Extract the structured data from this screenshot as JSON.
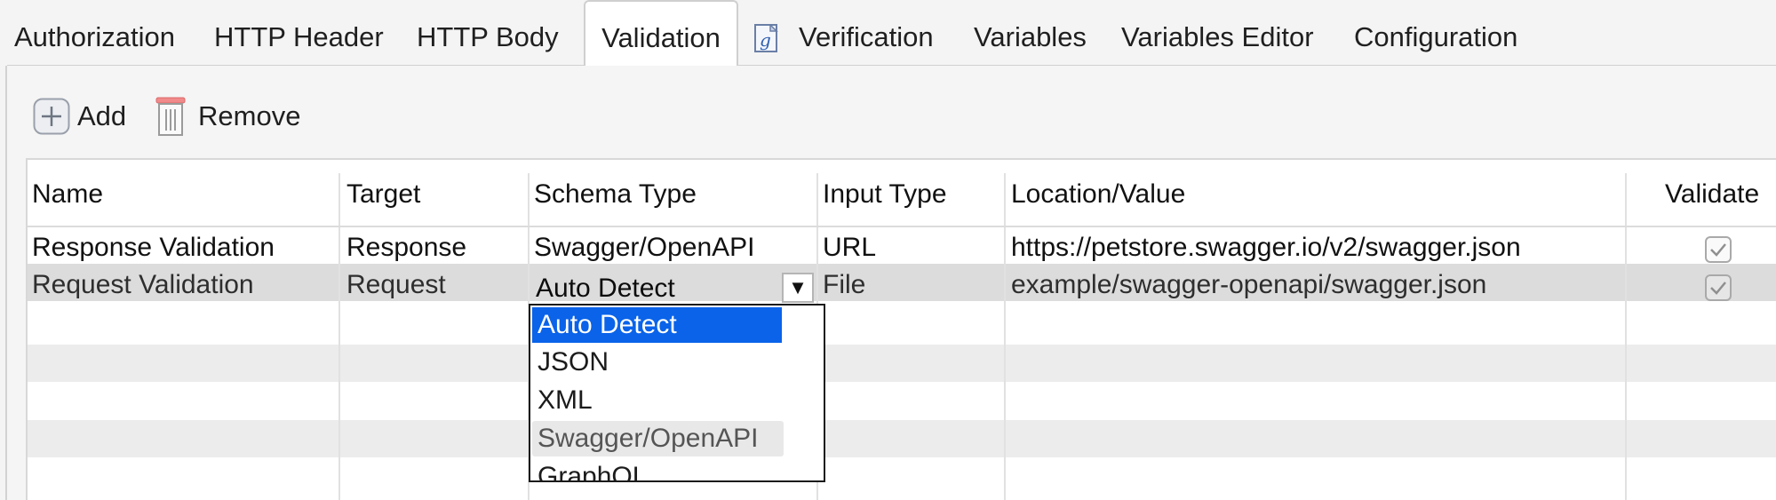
{
  "tabs": [
    {
      "label": "Authorization"
    },
    {
      "label": "HTTP Header"
    },
    {
      "label": "HTTP Body"
    },
    {
      "label": "Validation",
      "active": true
    },
    {
      "label": "Verification",
      "icon": "groovy-script-icon"
    },
    {
      "label": "Variables"
    },
    {
      "label": "Variables Editor"
    },
    {
      "label": "Configuration"
    }
  ],
  "toolbar": {
    "add_label": "Add",
    "add_icon": "plus-icon",
    "remove_label": "Remove",
    "remove_icon": "trash-icon"
  },
  "table": {
    "columns": [
      "Name",
      "Target",
      "Schema Type",
      "Input Type",
      "Location/Value",
      "Validate"
    ],
    "rows": [
      {
        "name": "Response Validation",
        "target": "Response",
        "schema_type": "Swagger/OpenAPI",
        "input_type": "URL",
        "location": "https://petstore.swagger.io/v2/swagger.json",
        "validate": true
      },
      {
        "name": "Request Validation",
        "target": "Request",
        "schema_type": "Auto Detect",
        "input_type": "File",
        "location": "example/swagger-openapi/swagger.json",
        "validate": true,
        "selected": true
      }
    ]
  },
  "schema_dropdown": {
    "current": "Auto Detect",
    "arrow": "▼",
    "options": [
      "Auto Detect",
      "JSON",
      "XML",
      "Swagger/OpenAPI",
      "GraphQL"
    ],
    "selected_option": "Auto Detect",
    "hovered_option": "Swagger/OpenAPI"
  },
  "colors": {
    "selection_blue": "#0a63e9",
    "row_selected": "#dcdcdc",
    "stripe": "#ececec"
  }
}
